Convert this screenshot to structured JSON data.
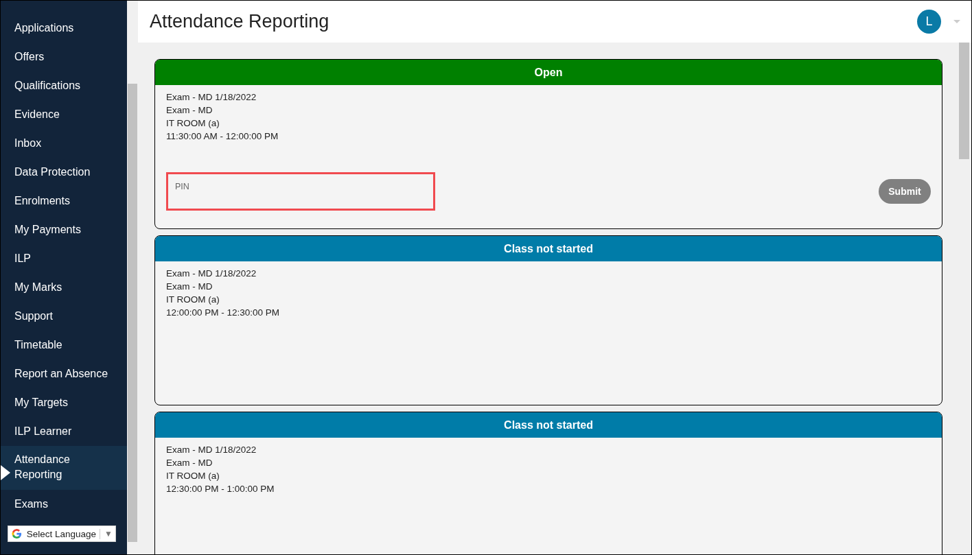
{
  "sidebar": {
    "items": [
      {
        "label": "Applications",
        "selected": false
      },
      {
        "label": "Offers",
        "selected": false
      },
      {
        "label": "Qualifications",
        "selected": false
      },
      {
        "label": "Evidence",
        "selected": false
      },
      {
        "label": "Inbox",
        "selected": false
      },
      {
        "label": "Data Protection",
        "selected": false
      },
      {
        "label": "Enrolments",
        "selected": false
      },
      {
        "label": "My Payments",
        "selected": false
      },
      {
        "label": "ILP",
        "selected": false
      },
      {
        "label": "My Marks",
        "selected": false
      },
      {
        "label": "Support",
        "selected": false
      },
      {
        "label": "Timetable",
        "selected": false
      },
      {
        "label": "Report an Absence",
        "selected": false
      },
      {
        "label": "My Targets",
        "selected": false
      },
      {
        "label": "ILP Learner",
        "selected": false
      },
      {
        "label": "Attendance Reporting",
        "selected": true
      },
      {
        "label": "Exams",
        "selected": false
      }
    ],
    "language_select": {
      "label": "Select Language",
      "arrow": "▼"
    }
  },
  "header": {
    "title": "Attendance Reporting",
    "avatar": "L"
  },
  "sessions": [
    {
      "kind": "pin",
      "status": "Open",
      "color": "#008000",
      "lines": [
        "Exam - MD 1/18/2022",
        "Exam - MD",
        "IT ROOM (a)",
        "11:30:00 AM - 12:00:00 PM"
      ],
      "pin": {
        "placeholder": "PIN",
        "highlighted": true
      },
      "submit": {
        "label": "Submit",
        "disabled": true
      }
    },
    {
      "kind": "info",
      "status": "Class not started",
      "color": "#007ca8",
      "lines": [
        "Exam - MD 1/18/2022",
        "Exam - MD",
        "IT ROOM (a)",
        "12:00:00 PM - 12:30:00 PM"
      ]
    },
    {
      "kind": "info",
      "status": "Class not started",
      "color": "#007ca8",
      "lines": [
        "Exam - MD 1/18/2022",
        "Exam - MD",
        "IT ROOM (a)",
        "12:30:00 PM - 1:00:00 PM"
      ]
    }
  ]
}
